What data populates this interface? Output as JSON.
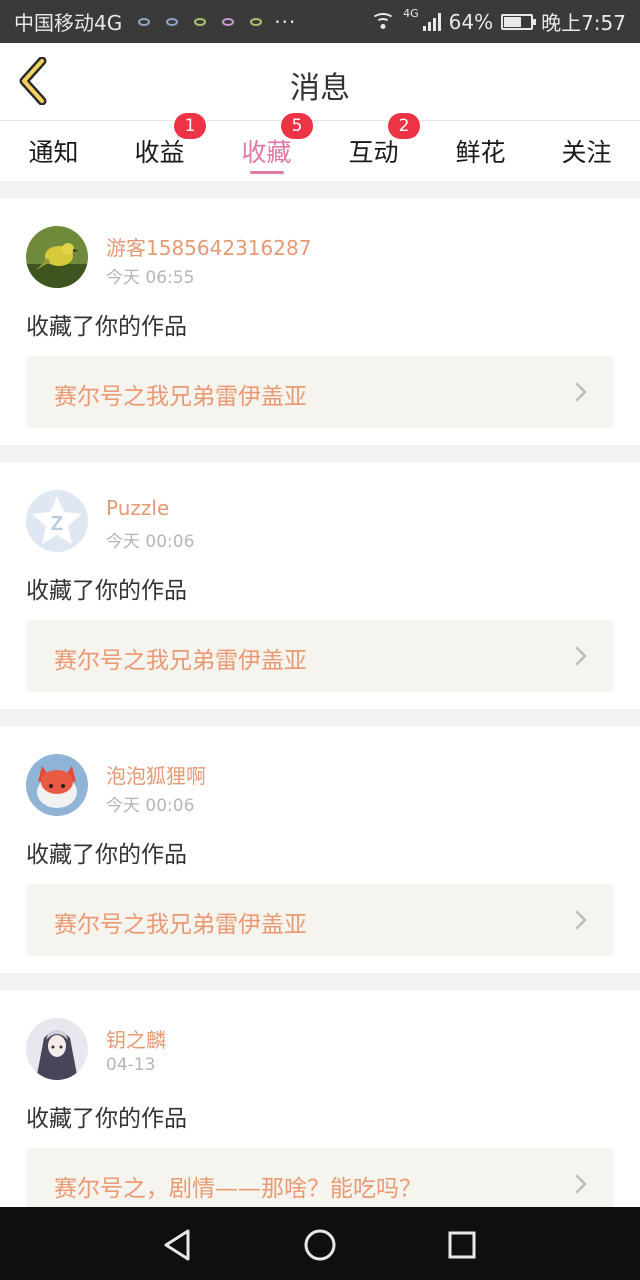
{
  "status_bar": {
    "carrier": "中国移动4G",
    "network_label": "4G",
    "battery": "64%",
    "battery_level": 0.64,
    "time": "晚上7:57"
  },
  "header": {
    "title": "消息",
    "back_icon": "chevron-left-icon"
  },
  "tabs": [
    {
      "label": "通知",
      "badge": ""
    },
    {
      "label": "收益",
      "badge": "1"
    },
    {
      "label": "收藏",
      "badge": "5",
      "active": true
    },
    {
      "label": "互动",
      "badge": "2"
    },
    {
      "label": "鲜花",
      "badge": ""
    },
    {
      "label": "关注",
      "badge": ""
    }
  ],
  "colors": {
    "accent_pink": "#e079a4",
    "username_orange": "#e69a74",
    "badge_red": "#ee3344",
    "work_bg": "#f5f4ee"
  },
  "messages": [
    {
      "user": "游客1585642316287",
      "time": "今天 06:55",
      "action": "收藏了你的作品",
      "work": "赛尔号之我兄弟雷伊盖亚"
    },
    {
      "user": "Puzzle",
      "time": "今天 00:06",
      "action": "收藏了你的作品",
      "work": "赛尔号之我兄弟雷伊盖亚"
    },
    {
      "user": "泡泡狐狸啊",
      "time": "今天 00:06",
      "action": "收藏了你的作品",
      "work": "赛尔号之我兄弟雷伊盖亚"
    },
    {
      "user": "钥之麟",
      "time": "04-13",
      "action": "收藏了你的作品",
      "work": "赛尔号之，剧情——那啥？能吃吗？"
    }
  ],
  "nav": {
    "back": "triangle-back-icon",
    "home": "circle-home-icon",
    "recents": "square-recents-icon"
  }
}
